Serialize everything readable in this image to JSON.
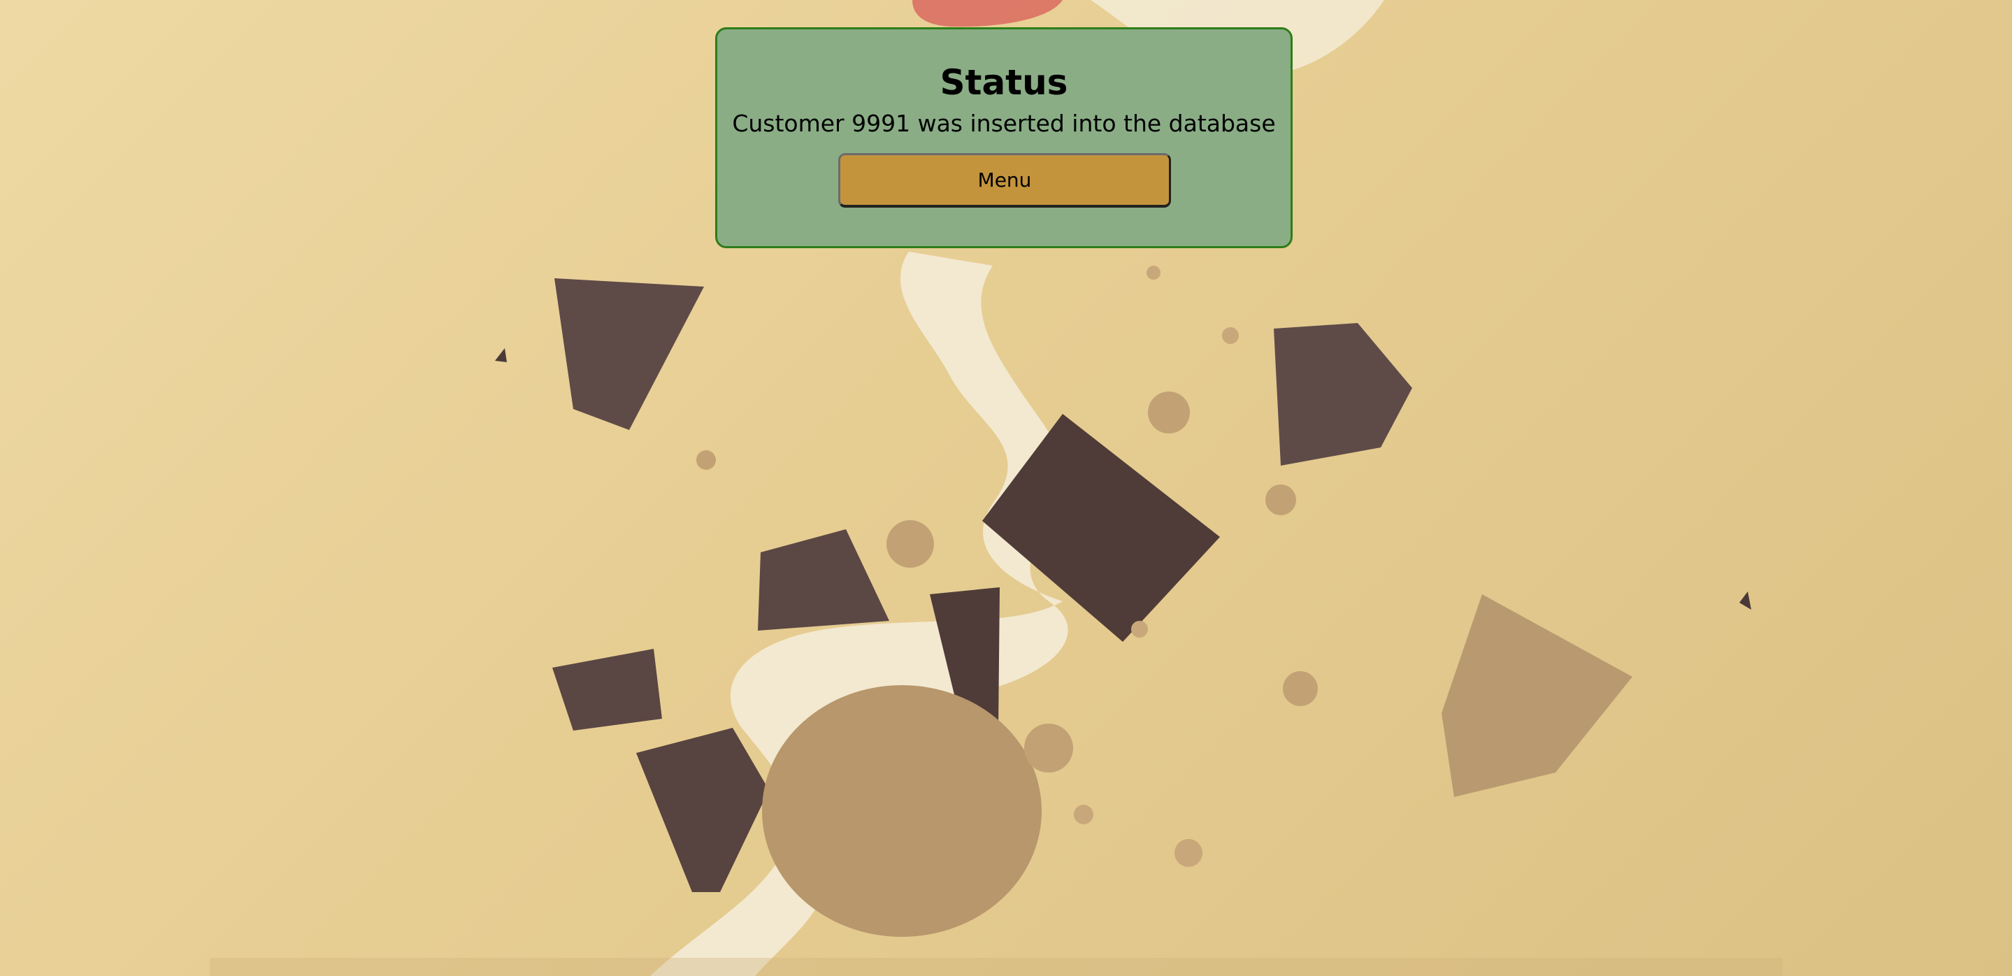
{
  "background": {
    "description_icon": "cookie-chocolate-cream-photo",
    "base_color": "#e8cf95"
  },
  "status": {
    "title": "Status",
    "message": "Customer 9991 was inserted into the database",
    "card_color": "#8aad86",
    "border_color": "#2e7d1a"
  },
  "actions": {
    "menu_label": "Menu",
    "menu_color": "#c4943c"
  }
}
